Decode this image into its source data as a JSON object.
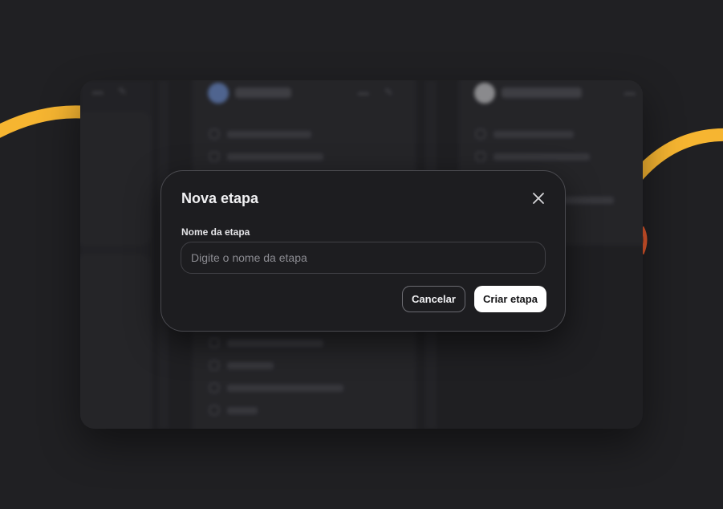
{
  "colors": {
    "background": "#202023",
    "accent_swoosh": "#f6b531",
    "modal_bg": "#1d1d20",
    "primary_button_bg": "#ffffff"
  },
  "modal": {
    "title": "Nova etapa",
    "close_icon": "close-icon",
    "field": {
      "label": "Nome da etapa",
      "value": "",
      "placeholder": "Digite o nome da etapa"
    },
    "buttons": {
      "cancel_label": "Cancelar",
      "create_label": "Criar etapa"
    }
  }
}
